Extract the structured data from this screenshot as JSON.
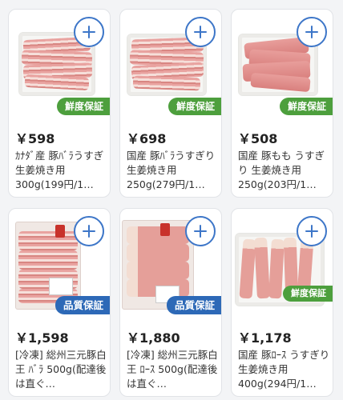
{
  "products": [
    {
      "price": "￥598",
      "name": "ｶﾅﾀﾞ産 豚ﾊﾞﾗうすぎ 生姜焼き用300g(199円/1…",
      "badge": "鮮度保証",
      "badge_type": "fresh",
      "image": "sliced-pork-belly-tray"
    },
    {
      "price": "￥698",
      "name": "国産 豚ﾊﾞﾗうすぎり 生姜焼き用250g(279円/1…",
      "badge": "鮮度保証",
      "badge_type": "fresh",
      "image": "sliced-pork-belly-tray"
    },
    {
      "price": "￥508",
      "name": "国産 豚もも うすぎり 生姜焼き用250g(203円/1…",
      "badge": "鮮度保証",
      "badge_type": "fresh",
      "image": "sliced-pork-thigh-tray"
    },
    {
      "price": "￥1,598",
      "name": "[冷凍] 総州三元豚白王 ﾊﾞﾗ 500g(配達後は直ぐ…",
      "badge": "品質保証",
      "badge_type": "quality",
      "image": "frozen-pork-belly-bag"
    },
    {
      "price": "￥1,880",
      "name": "[冷凍] 総州三元豚白王 ﾛｰｽ 500g(配達後は直ぐ…",
      "badge": "品質保証",
      "badge_type": "quality",
      "image": "frozen-pork-loin-bag"
    },
    {
      "price": "￥1,178",
      "name": "国産 豚ﾛｰｽ うすぎり 生姜焼き用400g(294円/1…",
      "badge": "鮮度保証",
      "badge_type": "fresh",
      "image": "sliced-pork-loin-tray"
    }
  ],
  "colors": {
    "fresh_badge": "#4d9f3d",
    "quality_badge": "#2d69b7",
    "add_button": "#3d76c8"
  },
  "icons": {
    "add": "plus-icon"
  }
}
